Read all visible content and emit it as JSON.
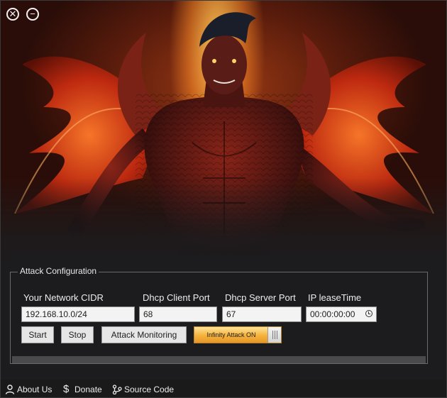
{
  "window_controls": {
    "close_glyph": "✕",
    "minimize_glyph": "−"
  },
  "config": {
    "group_title": "Attack Configuration",
    "labels": {
      "cidr": "Your Network CIDR",
      "client_port": "Dhcp Client Port",
      "server_port": "Dhcp Server Port",
      "lease_time": "IP leaseTime"
    },
    "values": {
      "cidr": "192.168.10.0/24",
      "client_port": "68",
      "server_port": "67",
      "lease_time": "00:00:00:00"
    },
    "buttons": {
      "start": "Start",
      "stop": "Stop",
      "monitoring": "Attack Monitoring"
    },
    "toggle": {
      "label": "Infinity Attack ON",
      "state": "on"
    },
    "progress": 0
  },
  "footer": {
    "about": "About Us",
    "donate": "Donate",
    "source": "Source Code"
  },
  "colors": {
    "accent_orange": "#f5b23a",
    "window_bg": "#1c1c1e",
    "hero_glow": "#ffcd5a"
  }
}
